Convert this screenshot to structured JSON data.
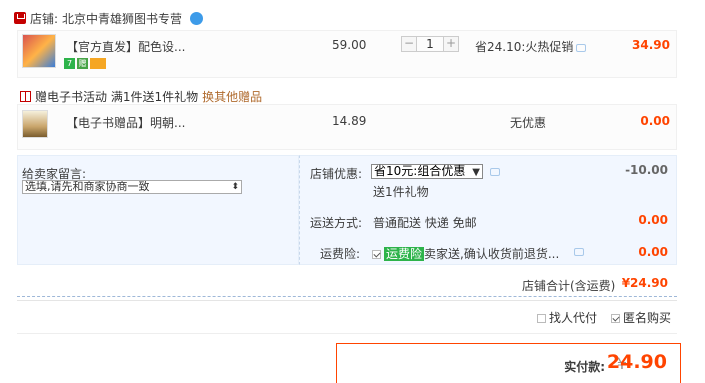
{
  "shop": {
    "label": "店铺:",
    "name": "北京中青雄狮图书专营"
  },
  "items": [
    {
      "title": "【官方直发】配色设...",
      "price": "59.00",
      "quantity": "1",
      "promo": "省24.10:火热促销",
      "total": "34.90",
      "badges": [
        "7",
        "赠",
        "卡"
      ]
    },
    {
      "title": "【电子书赠品】明朝...",
      "price": "14.89",
      "promo": "无优惠",
      "total": "0.00"
    }
  ],
  "gift": {
    "text": "赠电子书活动   满1件送1件礼物",
    "swap_link": "换其他赠品"
  },
  "message": {
    "label": "给卖家留言:",
    "placeholder": "选填,请先和商家协商一致"
  },
  "coupon": {
    "label": "店铺优惠:",
    "selected": "省10元:组合优惠",
    "amount": "-10.00",
    "gift_note": "送1件礼物"
  },
  "shipping": {
    "label": "运送方式:",
    "method": "普通配送 快递 免邮",
    "amount": "0.00"
  },
  "insurance": {
    "label": "运费险:",
    "tag": "运费险",
    "text": "卖家送,确认收货前退货...",
    "amount": "0.00"
  },
  "shop_total": {
    "label": "店铺合计(含运费)",
    "amount": "¥24.90"
  },
  "options": {
    "proxy_pay": "找人代付",
    "anonymous": "匿名购买"
  },
  "pay": {
    "label": "实付款:",
    "currency": "¥",
    "amount": "24.90"
  },
  "colors": {
    "accent": "#ff4400",
    "panel": "#f2f7ff",
    "green_tag": "#2db34a"
  }
}
